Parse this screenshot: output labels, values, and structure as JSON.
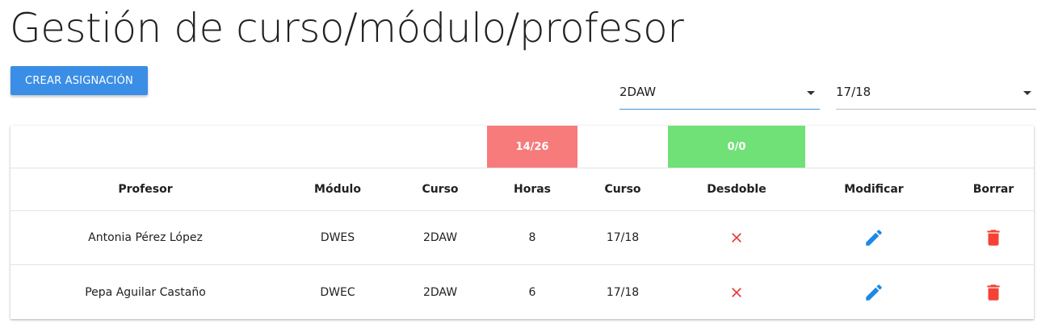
{
  "page": {
    "title": "Gestión de curso/módulo/profesor"
  },
  "toolbar": {
    "create_label": "CREAR ASIGNACIÓN"
  },
  "filters": {
    "course": {
      "value": "2DAW",
      "options": [
        "2DAW"
      ]
    },
    "year": {
      "value": "17/18",
      "options": [
        "17/18"
      ]
    }
  },
  "summary": {
    "hours": "14/26",
    "split": "0/0"
  },
  "table": {
    "columns": [
      "Profesor",
      "Módulo",
      "Curso",
      "Horas",
      "Curso",
      "Desdoble",
      "Modificar",
      "Borrar"
    ],
    "rows": [
      {
        "profesor": "Antonia Pérez López",
        "modulo": "DWES",
        "curso": "2DAW",
        "horas": "8",
        "anio": "17/18",
        "desdoble": "no"
      },
      {
        "profesor": "Pepa Aguilar Castaño",
        "modulo": "DWEC",
        "curso": "2DAW",
        "horas": "6",
        "anio": "17/18",
        "desdoble": "no"
      }
    ]
  },
  "icons": {
    "desdoble": "close-icon",
    "modificar": "pencil-icon",
    "borrar": "trash-icon"
  },
  "colors": {
    "primary": "#3a8ee6",
    "hours_badge": "#f77b7b",
    "split_badge": "#6fe177",
    "close": "#e53935",
    "edit": "#1e88e5",
    "delete": "#f44336"
  }
}
